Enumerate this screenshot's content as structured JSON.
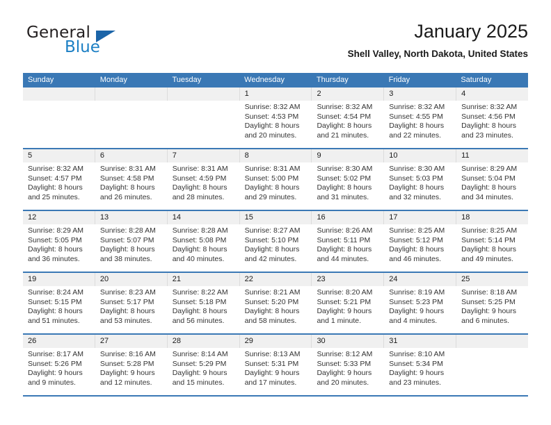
{
  "brand": {
    "name_part1": "General",
    "name_part2": "Blue",
    "triangle_color": "#1b64a8",
    "blue_color": "#1b7fc4"
  },
  "header": {
    "title": "January 2025",
    "subtitle": "Shell Valley, North Dakota, United States"
  },
  "theme": {
    "header_blue": "#3A78B5",
    "daynum_band": "#F0F0F0",
    "text": "#333333"
  },
  "weekdays": [
    "Sunday",
    "Monday",
    "Tuesday",
    "Wednesday",
    "Thursday",
    "Friday",
    "Saturday"
  ],
  "weeks": [
    {
      "days": [
        {
          "num": "",
          "lines": [
            "",
            "",
            "",
            ""
          ]
        },
        {
          "num": "",
          "lines": [
            "",
            "",
            "",
            ""
          ]
        },
        {
          "num": "",
          "lines": [
            "",
            "",
            "",
            ""
          ]
        },
        {
          "num": "1",
          "lines": [
            "Sunrise: 8:32 AM",
            "Sunset: 4:53 PM",
            "Daylight: 8 hours",
            "and 20 minutes."
          ]
        },
        {
          "num": "2",
          "lines": [
            "Sunrise: 8:32 AM",
            "Sunset: 4:54 PM",
            "Daylight: 8 hours",
            "and 21 minutes."
          ]
        },
        {
          "num": "3",
          "lines": [
            "Sunrise: 8:32 AM",
            "Sunset: 4:55 PM",
            "Daylight: 8 hours",
            "and 22 minutes."
          ]
        },
        {
          "num": "4",
          "lines": [
            "Sunrise: 8:32 AM",
            "Sunset: 4:56 PM",
            "Daylight: 8 hours",
            "and 23 minutes."
          ]
        }
      ]
    },
    {
      "days": [
        {
          "num": "5",
          "lines": [
            "Sunrise: 8:32 AM",
            "Sunset: 4:57 PM",
            "Daylight: 8 hours",
            "and 25 minutes."
          ]
        },
        {
          "num": "6",
          "lines": [
            "Sunrise: 8:31 AM",
            "Sunset: 4:58 PM",
            "Daylight: 8 hours",
            "and 26 minutes."
          ]
        },
        {
          "num": "7",
          "lines": [
            "Sunrise: 8:31 AM",
            "Sunset: 4:59 PM",
            "Daylight: 8 hours",
            "and 28 minutes."
          ]
        },
        {
          "num": "8",
          "lines": [
            "Sunrise: 8:31 AM",
            "Sunset: 5:00 PM",
            "Daylight: 8 hours",
            "and 29 minutes."
          ]
        },
        {
          "num": "9",
          "lines": [
            "Sunrise: 8:30 AM",
            "Sunset: 5:02 PM",
            "Daylight: 8 hours",
            "and 31 minutes."
          ]
        },
        {
          "num": "10",
          "lines": [
            "Sunrise: 8:30 AM",
            "Sunset: 5:03 PM",
            "Daylight: 8 hours",
            "and 32 minutes."
          ]
        },
        {
          "num": "11",
          "lines": [
            "Sunrise: 8:29 AM",
            "Sunset: 5:04 PM",
            "Daylight: 8 hours",
            "and 34 minutes."
          ]
        }
      ]
    },
    {
      "days": [
        {
          "num": "12",
          "lines": [
            "Sunrise: 8:29 AM",
            "Sunset: 5:05 PM",
            "Daylight: 8 hours",
            "and 36 minutes."
          ]
        },
        {
          "num": "13",
          "lines": [
            "Sunrise: 8:28 AM",
            "Sunset: 5:07 PM",
            "Daylight: 8 hours",
            "and 38 minutes."
          ]
        },
        {
          "num": "14",
          "lines": [
            "Sunrise: 8:28 AM",
            "Sunset: 5:08 PM",
            "Daylight: 8 hours",
            "and 40 minutes."
          ]
        },
        {
          "num": "15",
          "lines": [
            "Sunrise: 8:27 AM",
            "Sunset: 5:10 PM",
            "Daylight: 8 hours",
            "and 42 minutes."
          ]
        },
        {
          "num": "16",
          "lines": [
            "Sunrise: 8:26 AM",
            "Sunset: 5:11 PM",
            "Daylight: 8 hours",
            "and 44 minutes."
          ]
        },
        {
          "num": "17",
          "lines": [
            "Sunrise: 8:25 AM",
            "Sunset: 5:12 PM",
            "Daylight: 8 hours",
            "and 46 minutes."
          ]
        },
        {
          "num": "18",
          "lines": [
            "Sunrise: 8:25 AM",
            "Sunset: 5:14 PM",
            "Daylight: 8 hours",
            "and 49 minutes."
          ]
        }
      ]
    },
    {
      "days": [
        {
          "num": "19",
          "lines": [
            "Sunrise: 8:24 AM",
            "Sunset: 5:15 PM",
            "Daylight: 8 hours",
            "and 51 minutes."
          ]
        },
        {
          "num": "20",
          "lines": [
            "Sunrise: 8:23 AM",
            "Sunset: 5:17 PM",
            "Daylight: 8 hours",
            "and 53 minutes."
          ]
        },
        {
          "num": "21",
          "lines": [
            "Sunrise: 8:22 AM",
            "Sunset: 5:18 PM",
            "Daylight: 8 hours",
            "and 56 minutes."
          ]
        },
        {
          "num": "22",
          "lines": [
            "Sunrise: 8:21 AM",
            "Sunset: 5:20 PM",
            "Daylight: 8 hours",
            "and 58 minutes."
          ]
        },
        {
          "num": "23",
          "lines": [
            "Sunrise: 8:20 AM",
            "Sunset: 5:21 PM",
            "Daylight: 9 hours",
            "and 1 minute."
          ]
        },
        {
          "num": "24",
          "lines": [
            "Sunrise: 8:19 AM",
            "Sunset: 5:23 PM",
            "Daylight: 9 hours",
            "and 4 minutes."
          ]
        },
        {
          "num": "25",
          "lines": [
            "Sunrise: 8:18 AM",
            "Sunset: 5:25 PM",
            "Daylight: 9 hours",
            "and 6 minutes."
          ]
        }
      ]
    },
    {
      "days": [
        {
          "num": "26",
          "lines": [
            "Sunrise: 8:17 AM",
            "Sunset: 5:26 PM",
            "Daylight: 9 hours",
            "and 9 minutes."
          ]
        },
        {
          "num": "27",
          "lines": [
            "Sunrise: 8:16 AM",
            "Sunset: 5:28 PM",
            "Daylight: 9 hours",
            "and 12 minutes."
          ]
        },
        {
          "num": "28",
          "lines": [
            "Sunrise: 8:14 AM",
            "Sunset: 5:29 PM",
            "Daylight: 9 hours",
            "and 15 minutes."
          ]
        },
        {
          "num": "29",
          "lines": [
            "Sunrise: 8:13 AM",
            "Sunset: 5:31 PM",
            "Daylight: 9 hours",
            "and 17 minutes."
          ]
        },
        {
          "num": "30",
          "lines": [
            "Sunrise: 8:12 AM",
            "Sunset: 5:33 PM",
            "Daylight: 9 hours",
            "and 20 minutes."
          ]
        },
        {
          "num": "31",
          "lines": [
            "Sunrise: 8:10 AM",
            "Sunset: 5:34 PM",
            "Daylight: 9 hours",
            "and 23 minutes."
          ]
        },
        {
          "num": "",
          "lines": [
            "",
            "",
            "",
            ""
          ]
        }
      ]
    }
  ]
}
